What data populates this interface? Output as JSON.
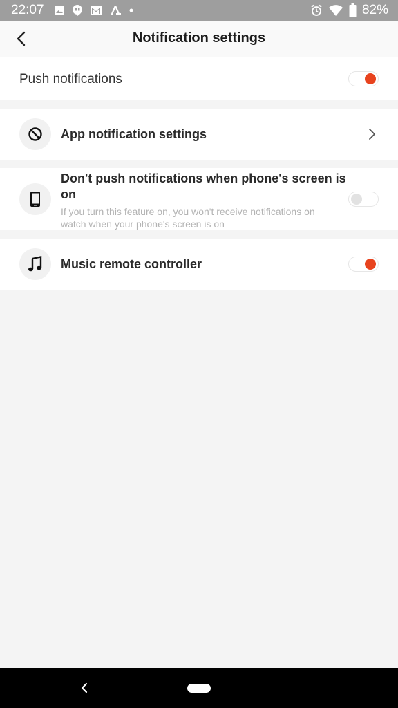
{
  "status_bar": {
    "time": "22:07",
    "battery": "82%",
    "icons_left": [
      "image-icon",
      "hangouts-icon",
      "gmail-icon",
      "font-icon",
      "dot-icon"
    ],
    "icons_right": [
      "alarm-icon",
      "wifi-icon",
      "battery-icon"
    ]
  },
  "header": {
    "title": "Notification settings",
    "back_icon": "chevron-left-icon"
  },
  "push": {
    "label": "Push notifications",
    "enabled": true
  },
  "app_settings": {
    "title": "App notification settings",
    "icon": "block-icon"
  },
  "screen_on": {
    "title": "Don't push notifications when phone's screen is on",
    "description": "If you turn this feature on, you won't receive notifications on watch when your phone's screen is on",
    "icon": "phone-icon",
    "enabled": false
  },
  "music": {
    "title": "Music remote controller",
    "icon": "music-note-icon",
    "enabled": true
  },
  "colors": {
    "accent": "#e8431e",
    "background": "#f4f4f4",
    "status_bar": "#9e9e9e"
  }
}
